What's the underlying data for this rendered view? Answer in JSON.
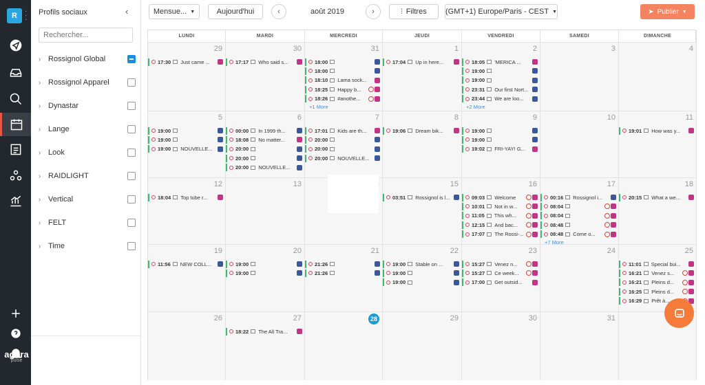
{
  "app": {
    "workspace_letter": "R",
    "logo": "agora",
    "logo_sub": "pulse"
  },
  "sidebar": {
    "title": "Profils sociaux",
    "search_placeholder": "Rechercher...",
    "profiles": [
      {
        "label": "Rossignol Global",
        "checked": true
      },
      {
        "label": "Rossignol Apparel",
        "checked": false
      },
      {
        "label": "Dynastar",
        "checked": false
      },
      {
        "label": "Lange",
        "checked": false
      },
      {
        "label": "Look",
        "checked": false
      },
      {
        "label": "RAIDLIGHT",
        "checked": false
      },
      {
        "label": "Vertical",
        "checked": false
      },
      {
        "label": "FELT",
        "checked": false
      },
      {
        "label": "Time",
        "checked": false
      }
    ]
  },
  "toolbar": {
    "view_label": "Mensue...",
    "today_label": "Aujourd'hui",
    "prev": "‹",
    "next": "›",
    "month": "août 2019",
    "filters_label": "Filtres",
    "timezone": "(GMT+1) Europe/Paris - CEST",
    "publish_label": "Publier"
  },
  "days": [
    "LUNDI",
    "MARDI",
    "MERCREDI",
    "JEUDI",
    "VENDREDI",
    "SAMEDI",
    "DIMANCHE"
  ],
  "weeks": [
    [
      {
        "n": "29",
        "gray": true,
        "posts": [
          {
            "t": "17:30",
            "x": "Just came ...",
            "n": "ig"
          }
        ]
      },
      {
        "n": "30",
        "gray": true,
        "posts": [
          {
            "t": "17:17",
            "x": "Who said s...",
            "n": "ig"
          }
        ]
      },
      {
        "n": "31",
        "gray": true,
        "posts": [
          {
            "t": "18:00",
            "x": "",
            "n": "fb"
          },
          {
            "t": "18:00",
            "x": "",
            "n": "fb"
          },
          {
            "t": "18:10",
            "x": "Lama sock...",
            "n": "ig"
          },
          {
            "t": "18:25",
            "x": "Happy b...",
            "n": "ig",
            "r": true
          },
          {
            "t": "18:26",
            "x": "#anothe...",
            "n": "ig",
            "r": true
          }
        ],
        "more": "+1 More"
      },
      {
        "n": "1",
        "gray": false,
        "posts": [
          {
            "t": "17:04",
            "x": "Up in here...",
            "n": "ig"
          }
        ]
      },
      {
        "n": "2",
        "gray": false,
        "posts": [
          {
            "t": "18:05",
            "x": "'MERICA ...",
            "n": "ig"
          },
          {
            "t": "19:00",
            "x": "",
            "n": "fb"
          },
          {
            "t": "19:00",
            "x": "",
            "n": "fb"
          },
          {
            "t": "23:31",
            "x": "Our first Nort...",
            "n": "fb"
          },
          {
            "t": "23:44",
            "x": "We are loo...",
            "n": "fb"
          }
        ],
        "more": "+2 More"
      },
      {
        "n": "3",
        "gray": false,
        "posts": []
      },
      {
        "n": "4",
        "gray": false,
        "posts": []
      }
    ],
    [
      {
        "n": "5",
        "gray": false,
        "posts": [
          {
            "t": "19:00",
            "x": "",
            "n": "fb"
          },
          {
            "t": "19:00",
            "x": "",
            "n": "fb"
          },
          {
            "t": "19:00",
            "x": "NOUVELLE...",
            "n": "fb"
          }
        ]
      },
      {
        "n": "6",
        "gray": false,
        "posts": [
          {
            "t": "00:00",
            "x": "In 1999 th...",
            "n": "fb"
          },
          {
            "t": "18:08",
            "x": "No matter...",
            "n": "ig"
          },
          {
            "t": "20:00",
            "x": "",
            "n": "fb"
          },
          {
            "t": "20:00",
            "x": "",
            "n": "fb"
          },
          {
            "t": "20:00",
            "x": "NOUVELLE...",
            "n": "fb"
          }
        ]
      },
      {
        "n": "7",
        "gray": false,
        "posts": [
          {
            "t": "17:01",
            "x": "Kids are th...",
            "n": "ig"
          },
          {
            "t": "20:00",
            "x": "",
            "n": "fb"
          },
          {
            "t": "20:00",
            "x": "",
            "n": "fb"
          },
          {
            "t": "20:00",
            "x": "NOUVELLE...",
            "n": "fb"
          }
        ]
      },
      {
        "n": "8",
        "gray": false,
        "posts": [
          {
            "t": "19:06",
            "x": "Dream bik...",
            "n": "ig"
          }
        ]
      },
      {
        "n": "9",
        "gray": false,
        "posts": [
          {
            "t": "19:00",
            "x": "",
            "n": "fb"
          },
          {
            "t": "19:00",
            "x": "",
            "n": "fb"
          },
          {
            "t": "19:02",
            "x": "FRI-YAY! G...",
            "n": "ig"
          }
        ]
      },
      {
        "n": "10",
        "gray": false,
        "posts": []
      },
      {
        "n": "11",
        "gray": false,
        "posts": [
          {
            "t": "19:01",
            "x": "How was y...",
            "n": "ig"
          }
        ]
      }
    ],
    [
      {
        "n": "12",
        "gray": false,
        "posts": [
          {
            "t": "18:04",
            "x": "Top tube r...",
            "n": "ig"
          }
        ]
      },
      {
        "n": "13",
        "gray": false,
        "posts": []
      },
      {
        "n": "14",
        "gray": false,
        "posts": []
      },
      {
        "n": "15",
        "gray": false,
        "posts": [
          {
            "t": "03:51",
            "x": "Rossignol is l...",
            "n": "fb"
          }
        ]
      },
      {
        "n": "16",
        "gray": false,
        "posts": [
          {
            "t": "09:03",
            "x": "Welcome",
            "n": "ig",
            "r": true
          },
          {
            "t": "10:01",
            "x": "Not in w...",
            "n": "ig",
            "r": true
          },
          {
            "t": "11:05",
            "x": "This wh...",
            "n": "ig",
            "r": true
          },
          {
            "t": "12:15",
            "x": "And bac...",
            "n": "ig",
            "r": true
          },
          {
            "t": "17:07",
            "x": "The Rossi-...",
            "n": "ig",
            "r": true
          }
        ]
      },
      {
        "n": "17",
        "gray": false,
        "posts": [
          {
            "t": "00:16",
            "x": "Rossignol i...",
            "n": "fb"
          },
          {
            "t": "08:04",
            "x": "",
            "n": "ig",
            "r": true
          },
          {
            "t": "08:04",
            "x": "",
            "n": "ig",
            "r": true
          },
          {
            "t": "08:48",
            "x": "",
            "n": "ig",
            "r": true
          },
          {
            "t": "08:48",
            "x": "Come o...",
            "n": "ig",
            "r": true
          }
        ],
        "more": "+7 More"
      },
      {
        "n": "18",
        "gray": false,
        "posts": [
          {
            "t": "20:15",
            "x": "What a we...",
            "n": "ig"
          }
        ]
      }
    ],
    [
      {
        "n": "19",
        "gray": false,
        "posts": [
          {
            "t": "11:56",
            "x": "NEW COLL...",
            "n": "fb"
          }
        ]
      },
      {
        "n": "20",
        "gray": false,
        "posts": [
          {
            "t": "19:00",
            "x": "",
            "n": "fb"
          },
          {
            "t": "19:00",
            "x": "",
            "n": "fb"
          }
        ]
      },
      {
        "n": "21",
        "gray": false,
        "posts": [
          {
            "t": "21:26",
            "x": "",
            "n": "fb"
          },
          {
            "t": "21:26",
            "x": "",
            "n": "fb"
          }
        ]
      },
      {
        "n": "22",
        "gray": false,
        "posts": [
          {
            "t": "19:00",
            "x": "Stable on ...",
            "n": "fb"
          },
          {
            "t": "19:00",
            "x": "",
            "n": "fb"
          },
          {
            "t": "19:00",
            "x": "",
            "n": "fb"
          }
        ]
      },
      {
        "n": "23",
        "gray": false,
        "posts": [
          {
            "t": "15:27",
            "x": "Venez n...",
            "n": "ig",
            "r": true
          },
          {
            "t": "15:27",
            "x": "Ce week...",
            "n": "ig",
            "r": true
          },
          {
            "t": "17:00",
            "x": "Get outsid...",
            "n": "ig"
          }
        ]
      },
      {
        "n": "24",
        "gray": false,
        "posts": []
      },
      {
        "n": "25",
        "gray": false,
        "posts": [
          {
            "t": "11:01",
            "x": "Special bui...",
            "n": "ig"
          },
          {
            "t": "16:21",
            "x": "Venez s...",
            "n": "ig",
            "r": true
          },
          {
            "t": "16:21",
            "x": "Pleins d...",
            "n": "ig",
            "r": true
          },
          {
            "t": "16:25",
            "x": "Pleins d...",
            "n": "ig",
            "r": true
          },
          {
            "t": "16:29",
            "x": "Prêt à...",
            "n": "ig",
            "r": true
          }
        ]
      }
    ],
    [
      {
        "n": "26",
        "gray": false,
        "posts": []
      },
      {
        "n": "27",
        "gray": false,
        "posts": [
          {
            "t": "18:22",
            "x": "The All Tra...",
            "n": "ig"
          }
        ]
      },
      {
        "n": "28",
        "gray": false,
        "today": true,
        "posts": []
      },
      {
        "n": "29",
        "gray": false,
        "posts": []
      },
      {
        "n": "30",
        "gray": false,
        "posts": []
      },
      {
        "n": "31",
        "gray": false,
        "posts": []
      },
      {
        "n": "1",
        "gray": false,
        "posts": []
      }
    ]
  ]
}
